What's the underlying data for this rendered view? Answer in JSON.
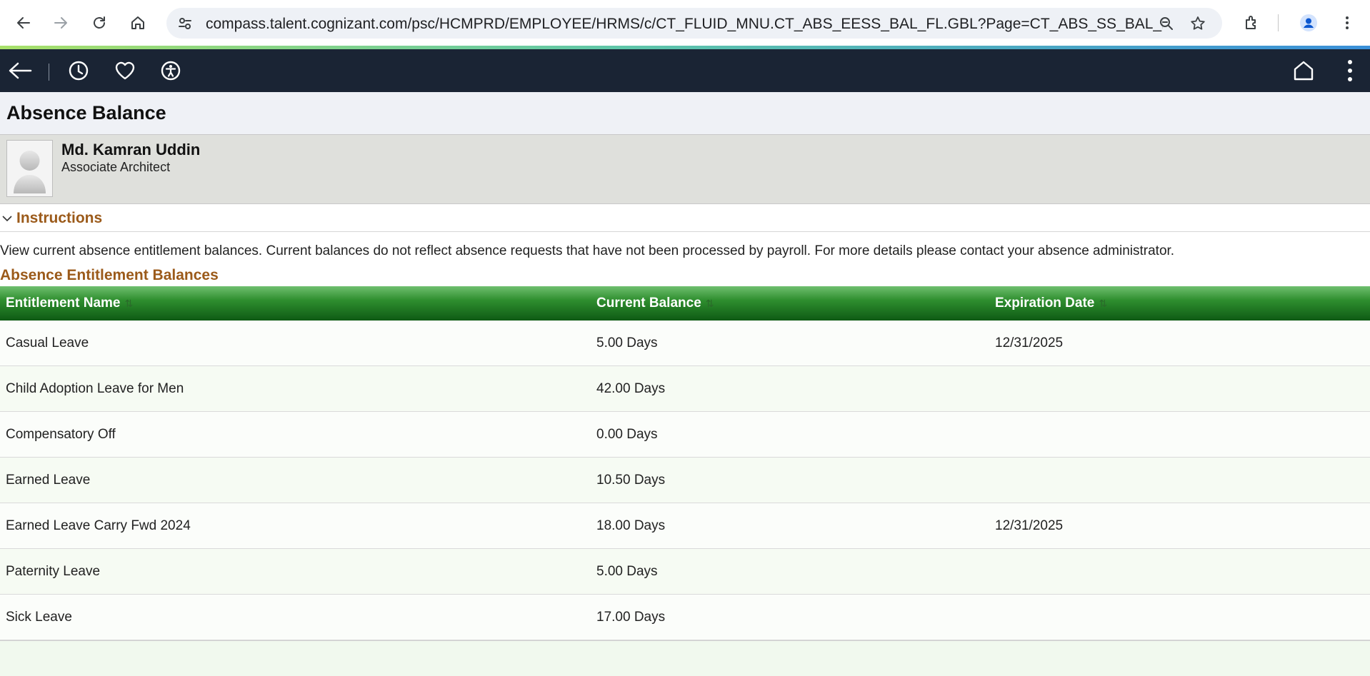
{
  "browser": {
    "url": "compass.talent.cognizant.com/psc/HCMPRD/EMPLOYEE/HRMS/c/CT_FLUID_MNU.CT_ABS_EESS_BAL_FL.GBL?Page=CT_ABS_SS_BAL_FL&Acti..."
  },
  "page": {
    "title": "Absence Balance"
  },
  "employee": {
    "name": "Md. Kamran Uddin",
    "job_title": "Associate Architect"
  },
  "instructions": {
    "label": "Instructions",
    "text": "View current absence entitlement balances. Current balances do not reflect absence requests that have not been processed by payroll. For more details please contact your absence administrator."
  },
  "balances": {
    "title": "Absence Entitlement Balances",
    "columns": [
      "Entitlement Name",
      "Current Balance",
      "Expiration Date"
    ],
    "rows": [
      {
        "name": "Casual Leave",
        "balance": "5.00 Days",
        "expiration": "12/31/2025"
      },
      {
        "name": "Child Adoption Leave for Men",
        "balance": "42.00 Days",
        "expiration": ""
      },
      {
        "name": "Compensatory Off",
        "balance": "0.00 Days",
        "expiration": ""
      },
      {
        "name": "Earned Leave",
        "balance": "10.50 Days",
        "expiration": ""
      },
      {
        "name": "Earned Leave Carry Fwd 2024",
        "balance": "18.00 Days",
        "expiration": "12/31/2025"
      },
      {
        "name": "Paternity Leave",
        "balance": "5.00 Days",
        "expiration": ""
      },
      {
        "name": "Sick Leave",
        "balance": "17.00 Days",
        "expiration": ""
      }
    ]
  },
  "colors": {
    "header_bg": "#1a2434",
    "section_title": "#9b5a1a",
    "grid_header": "#0e5a14"
  }
}
